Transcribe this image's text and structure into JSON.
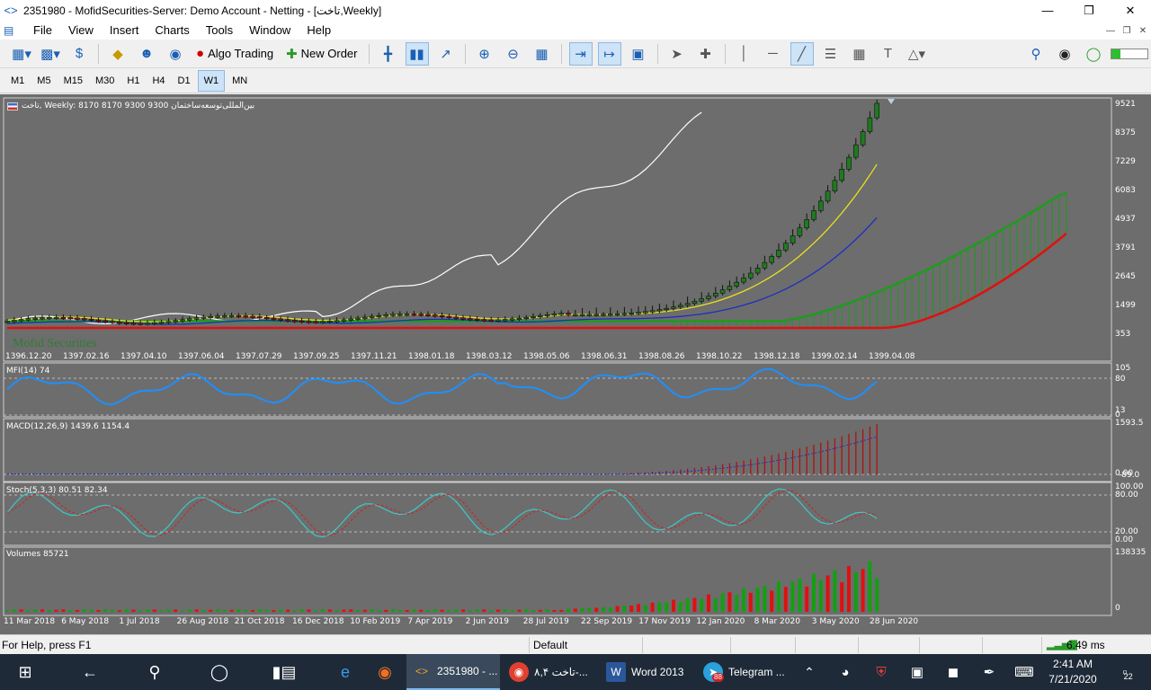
{
  "window": {
    "title": "2351980 - MofidSecurities-Server: Demo Account - Netting - [تاخت,Weekly]"
  },
  "menu": [
    "File",
    "View",
    "Insert",
    "Charts",
    "Tools",
    "Window",
    "Help"
  ],
  "toolbar": {
    "algo_trading": "Algo Trading",
    "new_order": "New Order"
  },
  "timeframes": [
    "M1",
    "M5",
    "M15",
    "M30",
    "H1",
    "H4",
    "D1",
    "W1",
    "MN"
  ],
  "active_timeframe": "W1",
  "chart": {
    "header": "تاخت, Weekly:  8170 8170 9300 9300  بین‌المللی‌توسعه‌ساختمان",
    "watermark": "Mofid Securities",
    "price_axis": [
      "9521",
      "8375",
      "7229",
      "6083",
      "4937",
      "3791",
      "2645",
      "1499",
      "353"
    ],
    "date_axis_main": [
      "1396.12.20",
      "1397.02.16",
      "1397.04.10",
      "1397.06.04",
      "1397.07.29",
      "1397.09.25",
      "1397.11.21",
      "1398.01.18",
      "1398.03.12",
      "1398.05.06",
      "1398.06.31",
      "1398.08.26",
      "1398.10.22",
      "1398.12.18",
      "1399.02.14",
      "1399.04.08"
    ],
    "date_axis_bottom": [
      "11 Mar 2018",
      "6 May 2018",
      "1 Jul 2018",
      "26 Aug 2018",
      "21 Oct 2018",
      "16 Dec 2018",
      "10 Feb 2019",
      "7 Apr 2019",
      "2 Jun 2019",
      "28 Jul 2019",
      "22 Sep 2019",
      "17 Nov 2019",
      "12 Jan 2020",
      "8 Mar 2020",
      "3 May 2020",
      "28 Jun 2020"
    ],
    "mfi": {
      "label": "MFI(14) 74",
      "axis": [
        "105",
        "80",
        "13",
        "0"
      ]
    },
    "macd": {
      "label": "MACD(12,26,9) 1439.6 1154.4",
      "axis": [
        "1593.5",
        "0.00",
        "-89.0"
      ]
    },
    "stoch": {
      "label": "Stoch(5,3,3) 80.51 82.34",
      "axis": [
        "100.00",
        "80.00",
        "20.00",
        "0.00"
      ]
    },
    "volumes": {
      "label": "Volumes 85721",
      "axis": [
        "138335",
        "0"
      ]
    },
    "colors": {
      "bg": "#6d6d6d",
      "bull": "#1e7b1e",
      "bear": "#c00000",
      "ma_fast": "#e8e020",
      "ma_slow": "#1c2fc0",
      "line_white": "#ffffff",
      "mfi": "#1e90ff",
      "stoch_main": "#3ec8c8",
      "stoch_signal": "#d02020",
      "vol_up": "#12a012",
      "vol_down": "#e01010"
    }
  },
  "status": {
    "help": "For Help, press F1",
    "profile": "Default",
    "ping": "6.49 ms"
  },
  "taskbar": {
    "apps": [
      {
        "label": "2351980 - ..."
      },
      {
        "label": "تاخت ۸,۴-..."
      },
      {
        "label": "Word 2013"
      },
      {
        "label": "Telegram ..."
      }
    ],
    "telegram_badge": "88",
    "notification_count": "22",
    "time": "2:41 AM",
    "date": "7/21/2020"
  }
}
